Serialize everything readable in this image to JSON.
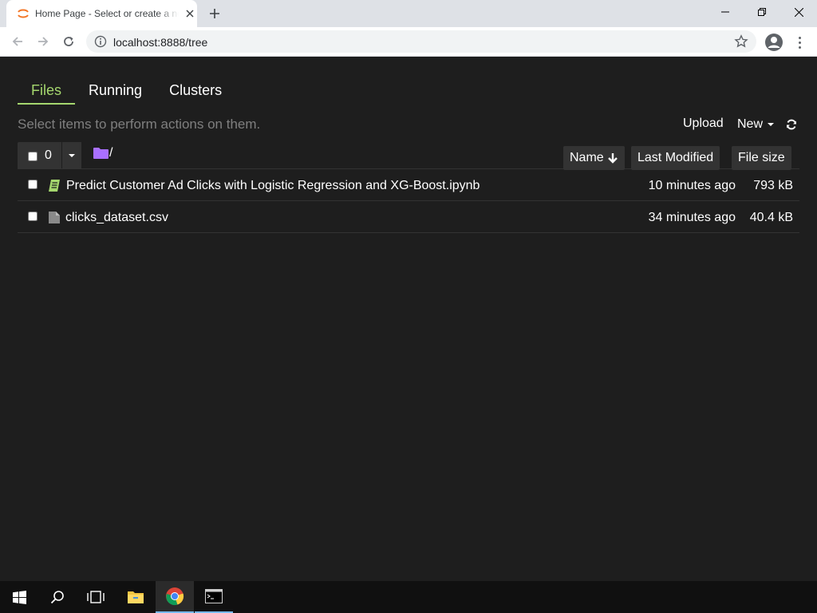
{
  "browser": {
    "tab_title": "Home Page - Select or create a notebook",
    "url": "localhost:8888/tree"
  },
  "tabs": [
    {
      "label": "Files",
      "active": true
    },
    {
      "label": "Running",
      "active": false
    },
    {
      "label": "Clusters",
      "active": false
    }
  ],
  "toolbar": {
    "hint": "Select items to perform actions on them.",
    "upload_label": "Upload",
    "new_label": "New",
    "selected_count": "0",
    "breadcrumb": "/"
  },
  "columns": {
    "name": "Name",
    "last_modified": "Last Modified",
    "file_size": "File size"
  },
  "files": [
    {
      "name": "Predict Customer Ad Clicks with Logistic Regression and XG-Boost.ipynb",
      "modified": "10 minutes ago",
      "size": "793 kB",
      "icon": "notebook-icon"
    },
    {
      "name": "clicks_dataset.csv",
      "modified": "34 minutes ago",
      "size": "40.4 kB",
      "icon": "file-icon"
    }
  ],
  "colors": {
    "accent": "#a5d76e",
    "background": "#1e1e1e",
    "folder": "#a970ff"
  }
}
